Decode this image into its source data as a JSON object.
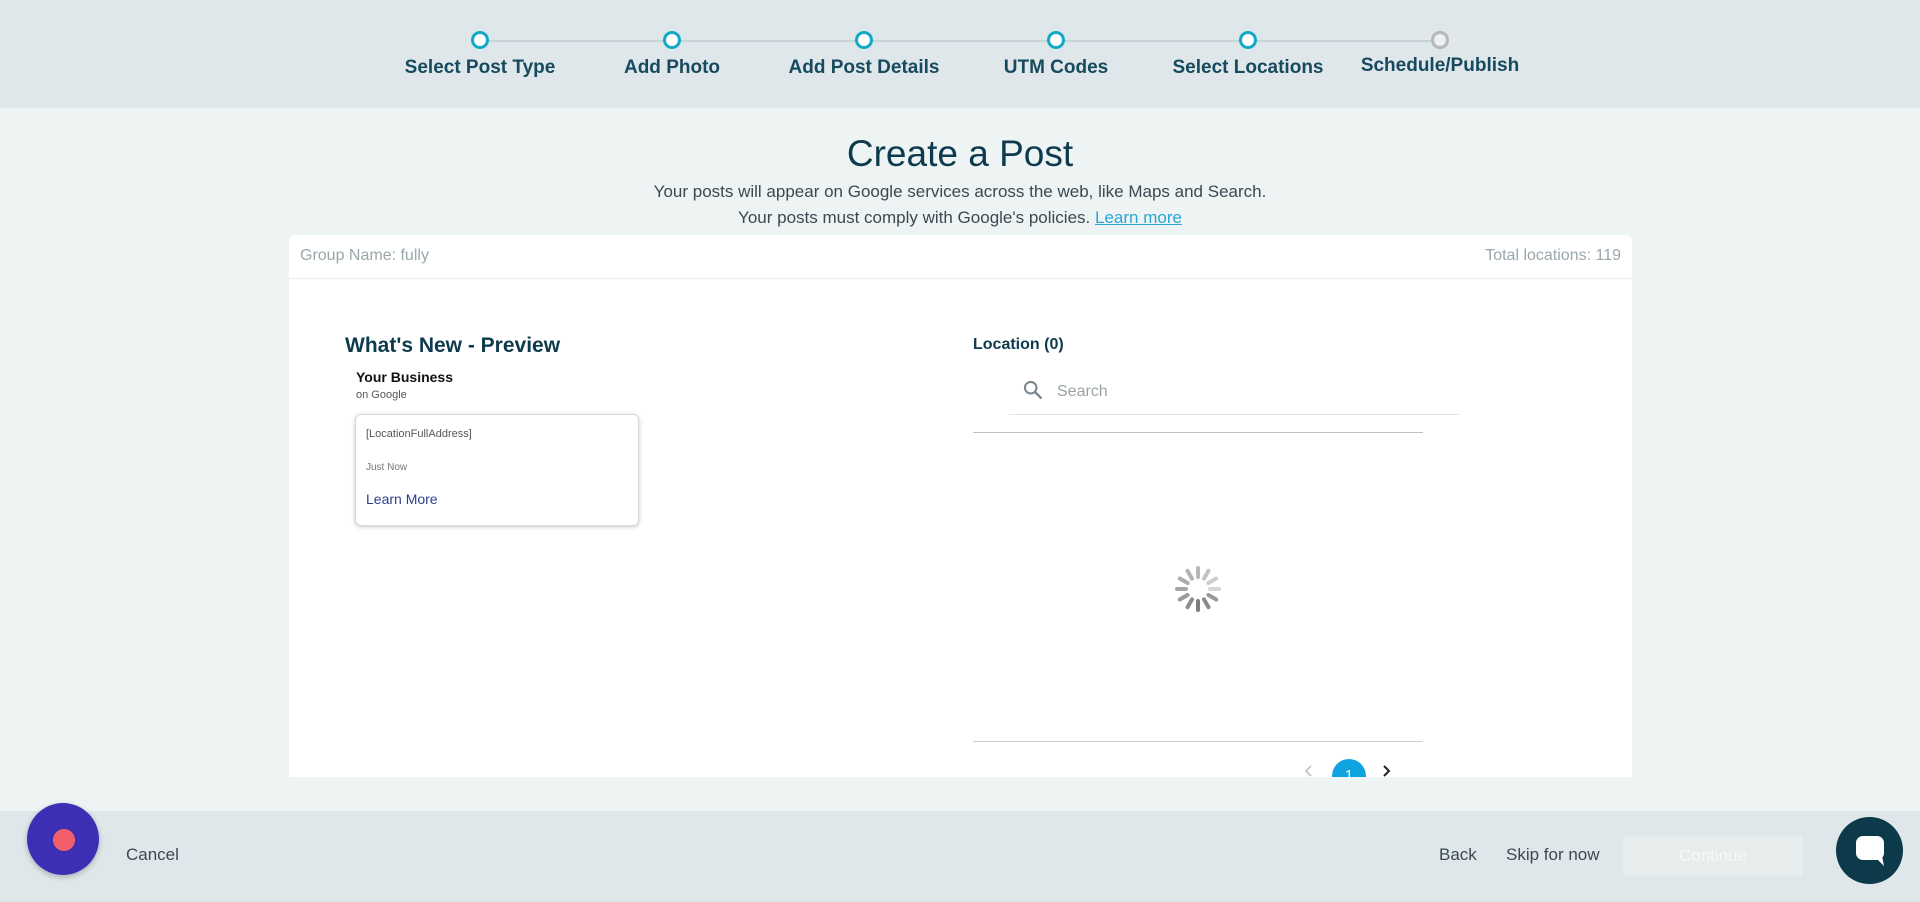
{
  "stepper": {
    "steps": [
      {
        "label": "Select Post Type",
        "state": "complete"
      },
      {
        "label": "Add Photo",
        "state": "complete"
      },
      {
        "label": "Add Post Details",
        "state": "complete"
      },
      {
        "label": "UTM Codes",
        "state": "complete"
      },
      {
        "label": "Select Locations",
        "state": "current"
      },
      {
        "label": "Schedule/Publish",
        "state": "pending"
      }
    ],
    "active_color": "#14a8c4",
    "pending_color": "#b4b9bc"
  },
  "header": {
    "title": "Create a Post",
    "line1": "Your posts will appear on Google services across the web, like Maps and Search.",
    "line2": "Your posts must comply with Google's policies.",
    "learn_more": "Learn more"
  },
  "card": {
    "group_name": "Group Name: fully",
    "total_locations": "Total locations: 119"
  },
  "preview": {
    "title": "What's New - Preview",
    "business_name": "Your Business",
    "business_sub": "on Google",
    "address": "[LocationFullAddress]",
    "time": "Just Now",
    "cta": "Learn More"
  },
  "locations": {
    "title": "Location (0)",
    "search_placeholder": "Search",
    "search_value": "",
    "loading": true,
    "current_page": "1"
  },
  "footer": {
    "cancel": "Cancel",
    "back": "Back",
    "skip": "Skip for now",
    "continue": "Continue"
  },
  "icons": {
    "search": "search-icon",
    "spinner": "loading-spinner-icon",
    "prev": "chevron-left-icon",
    "next": "chevron-right-icon",
    "chat": "chat-bubble-icon"
  },
  "colors": {
    "brand_dark": "#0d3b4d",
    "accent": "#14a8c4",
    "link": "#2aa6d6",
    "pagination": "#0fa3e0",
    "fab": "#3c2fb4"
  }
}
